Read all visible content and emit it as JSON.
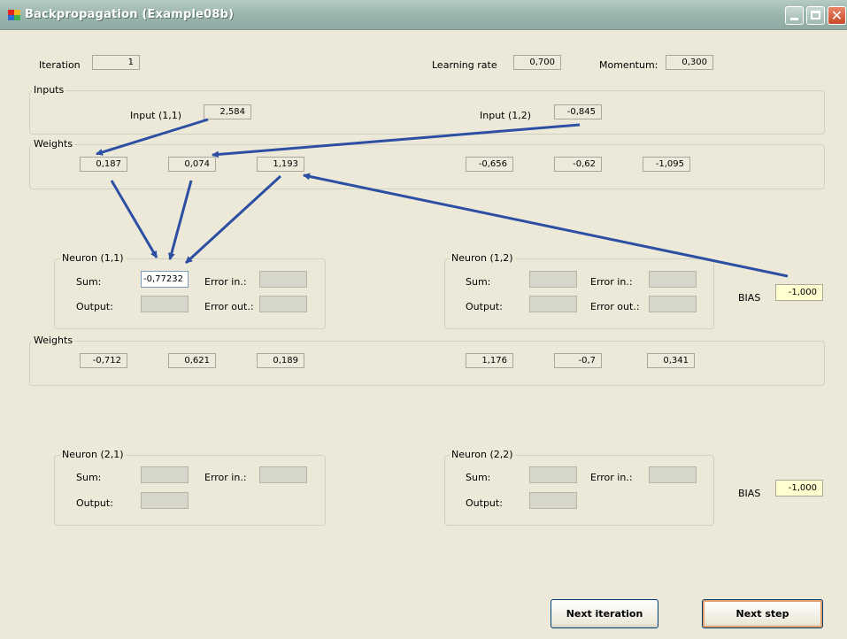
{
  "window": {
    "title": "Backpropagation (Example08b)",
    "close_glyph": "✕"
  },
  "top": {
    "iteration_label": "Iteration",
    "iteration_value": "1",
    "learning_rate_label": "Learning rate",
    "learning_rate_value": "0,700",
    "momentum_label": "Momentum:",
    "momentum_value": "0,300"
  },
  "inputs": {
    "group_label": "Inputs",
    "input11_label": "Input (1,1)",
    "input11_value": "2,584",
    "input12_label": "Input (1,2)",
    "input12_value": "-0,845"
  },
  "weights1": {
    "group_label": "Weights",
    "values": [
      "0,187",
      "0,074",
      "1,193",
      "-0,656",
      "-0,62",
      "-1,095"
    ]
  },
  "neuron11": {
    "group_label": "Neuron (1,1)",
    "sum_label": "Sum:",
    "sum_value": "-0,77232",
    "output_label": "Output:",
    "error_in_label": "Error in.:",
    "error_out_label": "Error out.:"
  },
  "neuron12": {
    "group_label": "Neuron (1,2)",
    "sum_label": "Sum:",
    "output_label": "Output:",
    "error_in_label": "Error in.:",
    "error_out_label": "Error out.:"
  },
  "bias1": {
    "label": "BIAS",
    "value": "-1,000"
  },
  "weights2": {
    "group_label": "Weights",
    "values": [
      "-0,712",
      "0,621",
      "0,189",
      "1,176",
      "-0,7",
      "0,341"
    ]
  },
  "neuron21": {
    "group_label": "Neuron (2,1)",
    "sum_label": "Sum:",
    "output_label": "Output:",
    "error_in_label": "Error in.:"
  },
  "neuron22": {
    "group_label": "Neuron (2,2)",
    "sum_label": "Sum:",
    "output_label": "Output:",
    "error_in_label": "Error in.:"
  },
  "bias2": {
    "label": "BIAS",
    "value": "-1,000"
  },
  "buttons": {
    "next_iteration": "Next iteration",
    "next_step": "Next step"
  },
  "colors": {
    "arrow": "#2d4fa3",
    "bias_field": "#ffffd0"
  }
}
